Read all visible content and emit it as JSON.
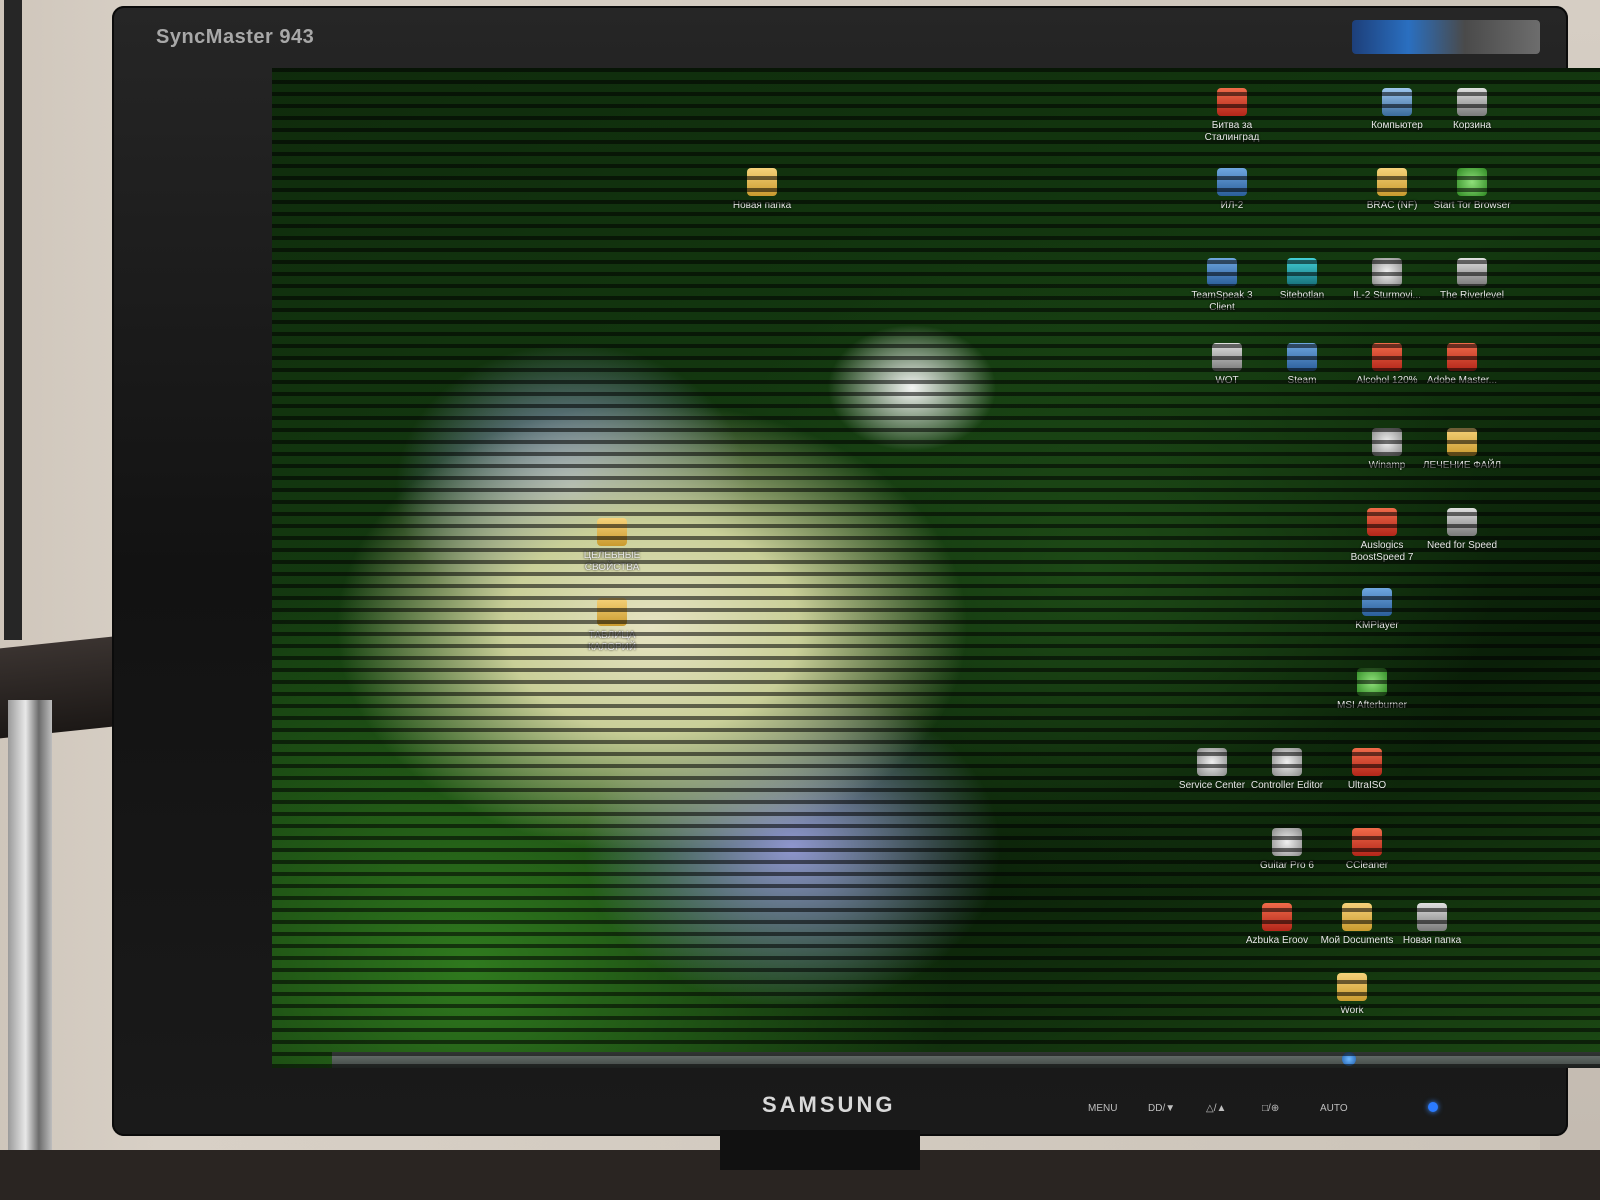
{
  "monitor": {
    "model": "SyncMaster 943",
    "brand": "SAMSUNG",
    "buttons": [
      "MENU",
      "DD/▼",
      "△/▲",
      "□/⊕",
      "AUTO"
    ]
  },
  "desktop_icons": [
    {
      "label": "Новая папка",
      "glyph": "folder"
    },
    {
      "label": "Битва за Сталинград",
      "glyph": "red"
    },
    {
      "label": "Компьютер",
      "glyph": "pc"
    },
    {
      "label": "Корзина",
      "glyph": "gray"
    },
    {
      "label": "ИЛ-2",
      "glyph": "blue"
    },
    {
      "label": "BRAC (NF)",
      "glyph": "folder"
    },
    {
      "label": "Start Tor Browser",
      "glyph": "green"
    },
    {
      "label": "TeamSpeak 3 Client",
      "glyph": "blue"
    },
    {
      "label": "Sitebotlan",
      "glyph": "teal"
    },
    {
      "label": "IL-2 Sturmovi...",
      "glyph": "silver"
    },
    {
      "label": "The Riverlevel",
      "glyph": "gray"
    },
    {
      "label": "WOT",
      "glyph": "gray"
    },
    {
      "label": "Steam",
      "glyph": "blue"
    },
    {
      "label": "Alcohol 120%",
      "glyph": "red"
    },
    {
      "label": "Adobe Master...",
      "glyph": "red"
    },
    {
      "label": "Winamp",
      "glyph": "silver"
    },
    {
      "label": "ЛЕЧЕНИЕ ФАЙЛ",
      "glyph": "folder"
    },
    {
      "label": "Auslogics BoostSpeed 7",
      "glyph": "red"
    },
    {
      "label": "Need for Speed",
      "glyph": "gray"
    },
    {
      "label": "ЦЕЛЕБНЫЕ СВОЙСТВА",
      "glyph": "folder"
    },
    {
      "label": "KMPlayer",
      "glyph": "blue"
    },
    {
      "label": "ТАБЛИЦА КАЛОРИЙ",
      "glyph": "folder"
    },
    {
      "label": "MSI Afterburner",
      "glyph": "green"
    },
    {
      "label": "Service Center",
      "glyph": "silver"
    },
    {
      "label": "Controller Editor",
      "glyph": "silver"
    },
    {
      "label": "UltraISO",
      "glyph": "red"
    },
    {
      "label": "Guitar Pro 6",
      "glyph": "silver"
    },
    {
      "label": "CCleaner",
      "glyph": "red"
    },
    {
      "label": "Azbuka Eroov",
      "glyph": "red"
    },
    {
      "label": "Mой Documents",
      "glyph": "folder"
    },
    {
      "label": "Новая папка",
      "glyph": "gray"
    },
    {
      "label": "Work",
      "glyph": "folder"
    }
  ]
}
